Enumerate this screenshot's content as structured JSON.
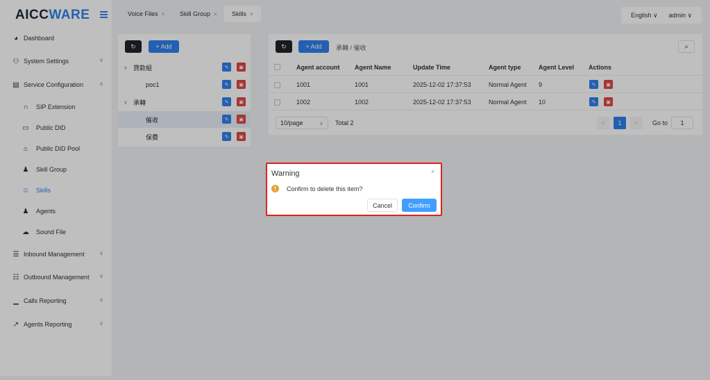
{
  "brand": {
    "prefix": "AICC",
    "suffix": "WARE"
  },
  "sidebar": {
    "items": [
      {
        "label": "Dashboard",
        "icon": "dashboard-icon",
        "glyph": "◕",
        "chevron": ""
      },
      {
        "label": "System Settings",
        "icon": "users-cog-icon",
        "glyph": "⚇",
        "chevron": "∨"
      },
      {
        "label": "Service Configuration",
        "icon": "id-card-icon",
        "glyph": "▤",
        "chevron": "∧"
      },
      {
        "label": "SIP Extension",
        "icon": "headset-icon",
        "glyph": "∩"
      },
      {
        "label": "Public DID",
        "icon": "folder-icon",
        "glyph": "▭"
      },
      {
        "label": "Public DID Pool",
        "icon": "home-icon",
        "glyph": "⌂"
      },
      {
        "label": "Skill Group",
        "icon": "user-group-icon",
        "glyph": "♟"
      },
      {
        "label": "Skills",
        "icon": "user-outline-icon",
        "glyph": "☺"
      },
      {
        "label": "Agents",
        "icon": "user-icon",
        "glyph": "♟"
      },
      {
        "label": "Sound File",
        "icon": "cloud-upload-icon",
        "glyph": "☁"
      },
      {
        "label": "Inbound Management",
        "icon": "list-icon",
        "glyph": "☰",
        "chevron": "∨"
      },
      {
        "label": "Outbound Management",
        "icon": "grid-list-icon",
        "glyph": "☷",
        "chevron": "∨"
      },
      {
        "label": "Calls Reporting",
        "icon": "bar-chart-icon",
        "glyph": "▁",
        "chevron": "∨"
      },
      {
        "label": "Agents Reporting",
        "icon": "line-chart-icon",
        "glyph": "↗",
        "chevron": "∨"
      }
    ]
  },
  "tabs": [
    {
      "label": "Voice Files",
      "close": "×"
    },
    {
      "label": "Skill Group",
      "close": "×"
    },
    {
      "label": "Skills",
      "close": "×"
    }
  ],
  "header": {
    "language": "English ∨",
    "user": "admin ∨"
  },
  "left_panel": {
    "add_label": "+ Add",
    "refresh_glyph": "↻",
    "tree": [
      {
        "label": "貸款組",
        "toggle": "∨"
      },
      {
        "label": "poc1",
        "toggle": ""
      },
      {
        "label": "承轉",
        "toggle": "∨"
      },
      {
        "label": "催收",
        "toggle": ""
      },
      {
        "label": "保費",
        "toggle": ""
      }
    ],
    "edit_glyph": "✎",
    "delete_glyph": "▣"
  },
  "right_panel": {
    "add_label": "+ Add",
    "refresh_glyph": "↻",
    "breadcrumb": "承轉  /  催收",
    "search_glyph": "⌕",
    "columns": [
      "Agent account",
      "Agent Name",
      "Update Time",
      "Agent type",
      "Agent Level",
      "Actions"
    ],
    "rows": [
      [
        "1001",
        "1001",
        "2025-12-02 17:37:53",
        "Normal Agent",
        "9"
      ],
      [
        "1002",
        "1002",
        "2025-12-02 17:37:53",
        "Normal Agent",
        "10"
      ]
    ],
    "pagination": {
      "page_size": "10/page",
      "page_size_arrow": "∨",
      "total": "Total 2",
      "prev": "<",
      "current": "1",
      "next": ">",
      "goto_label": "Go to",
      "goto_value": "1"
    }
  },
  "dialog": {
    "title": "Warning",
    "close": "×",
    "warn_glyph": "!",
    "message": "Confirm to delete this item?",
    "cancel": "Cancel",
    "confirm": "Confirm"
  }
}
